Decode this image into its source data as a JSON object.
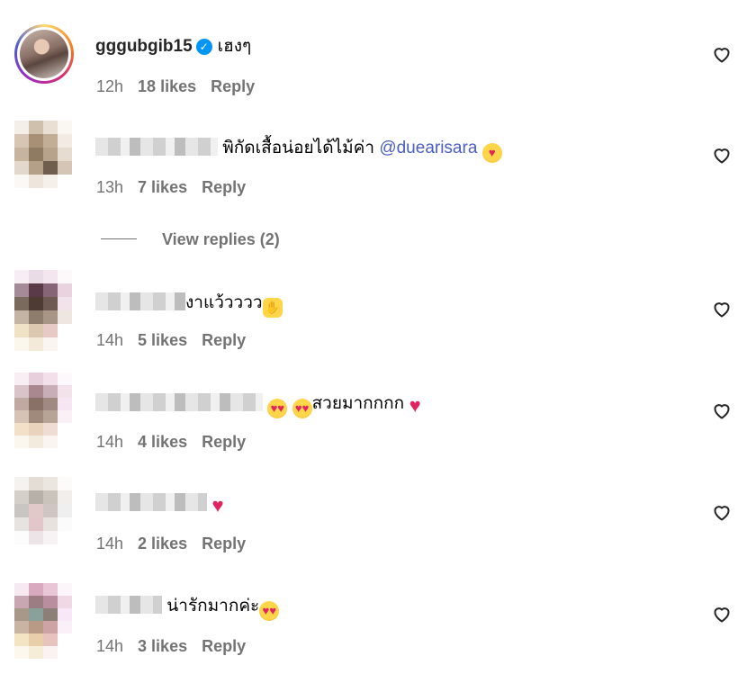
{
  "comments": [
    {
      "username": "gggubgib15",
      "text": "เฮงๆ",
      "time": "12h",
      "likes": "18 likes",
      "reply": "Reply"
    },
    {
      "text": "พิกัดเสื้อน่อยได้ไม้ค่า",
      "mention": "@duearisara",
      "time": "13h",
      "likes": "7 likes",
      "reply": "Reply"
    },
    {
      "text": "งาแว้วววว",
      "time": "14h",
      "likes": "5 likes",
      "reply": "Reply"
    },
    {
      "text": "สวยมากกกก",
      "time": "14h",
      "likes": "4 likes",
      "reply": "Reply"
    },
    {
      "text": "",
      "time": "14h",
      "likes": "2 likes",
      "reply": "Reply"
    },
    {
      "text": "น่ารักมากค่ะ",
      "time": "14h",
      "likes": "3 likes",
      "reply": "Reply"
    }
  ],
  "view_replies": "View replies (2)",
  "icons": {
    "verified": "verified-badge-icon",
    "like": "heart-outline-icon"
  },
  "colors": {
    "verified": "#0095f6",
    "mention": "#4a5fc1",
    "meta": "#737373"
  }
}
